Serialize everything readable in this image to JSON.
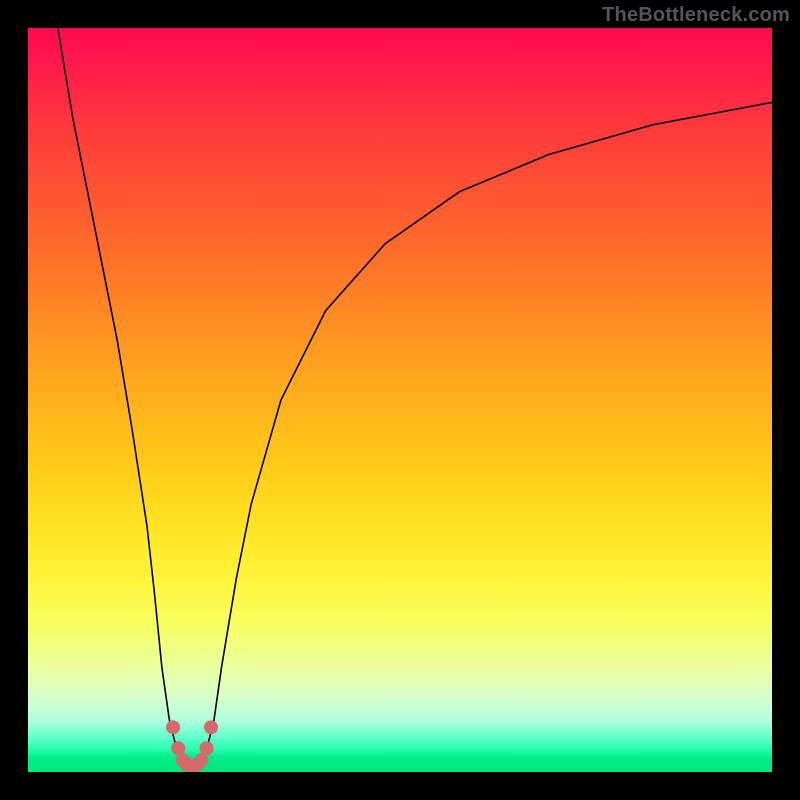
{
  "watermark": "TheBottleneck.com",
  "chart_data": {
    "type": "line",
    "title": "",
    "xlabel": "",
    "ylabel": "",
    "xlim": [
      0,
      100
    ],
    "ylim": [
      0,
      100
    ],
    "grid": false,
    "legend": false,
    "background_gradient": {
      "direction": "vertical",
      "stops": [
        {
          "pos": 0,
          "color": "#ff0a52"
        },
        {
          "pos": 14,
          "color": "#ff3b3b"
        },
        {
          "pos": 34,
          "color": "#ff7a26"
        },
        {
          "pos": 56,
          "color": "#ffc218"
        },
        {
          "pos": 74,
          "color": "#fff43a"
        },
        {
          "pos": 90,
          "color": "#d6ffcc"
        },
        {
          "pos": 100,
          "color": "#00e67e"
        }
      ]
    },
    "series": [
      {
        "name": "bottleneck-curve",
        "color": "#000000",
        "width": 1.6,
        "x": [
          4,
          6,
          8,
          10,
          12,
          14,
          16,
          17,
          18,
          19,
          20,
          21,
          22,
          23,
          24,
          25,
          26,
          28,
          30,
          34,
          40,
          48,
          58,
          70,
          84,
          100
        ],
        "y": [
          100,
          88,
          78,
          68,
          58,
          46,
          33,
          24,
          14,
          7,
          3,
          1,
          0.8,
          1,
          3,
          7,
          14,
          26,
          36,
          50,
          62,
          71,
          78,
          83,
          87,
          90
        ]
      }
    ],
    "markers": {
      "name": "minimum-region",
      "color": "#d46a6c",
      "radius": 7,
      "x": [
        19.5,
        20.2,
        20.8,
        21.3,
        22.0,
        22.7,
        23.3,
        24.0,
        24.6
      ],
      "y": [
        6.0,
        3.2,
        1.6,
        1.0,
        0.8,
        1.0,
        1.6,
        3.2,
        6.0
      ]
    }
  }
}
